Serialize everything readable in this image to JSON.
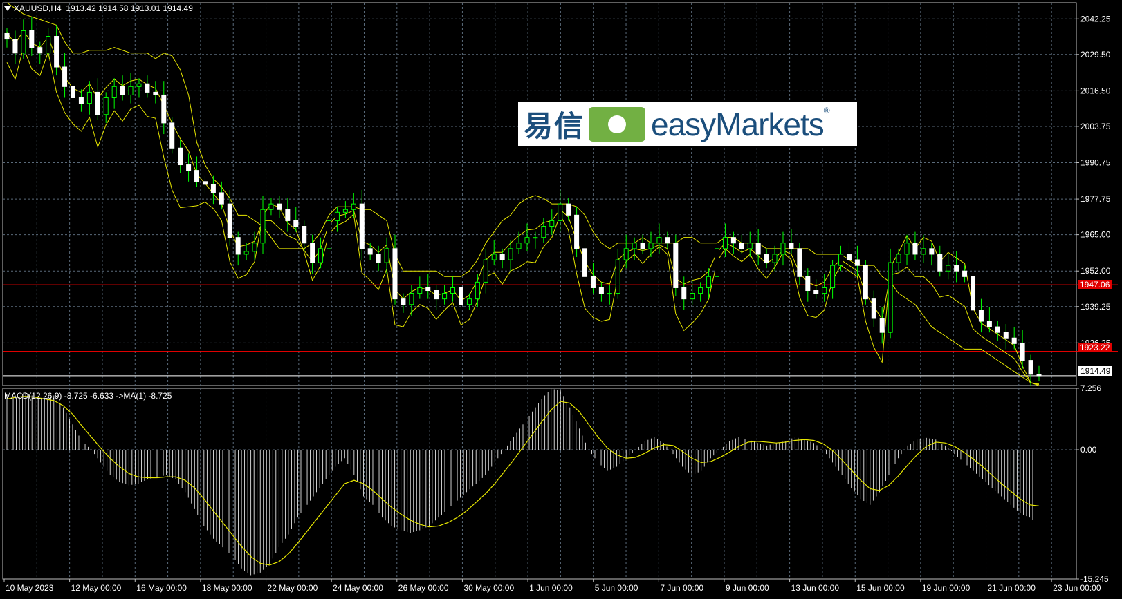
{
  "header": {
    "symbol": "XAUUSD,H4",
    "ohlc": "1913.42 1914.58 1913.01 1914.49"
  },
  "macd_header": {
    "text": "MACD(12,26,9) -8.725 -6.633 ->MA(1) -8.725"
  },
  "price_tags": {
    "resistance_1": "1947.06",
    "resistance_2": "1923.22",
    "current": "1914.49"
  },
  "logo": {
    "chinese": "易信",
    "brand": "easyMarkets",
    "reg": "®"
  },
  "colors": {
    "bull": "#00ff00",
    "bear": "#ffffff",
    "band": "#e8e800",
    "grid": "#5a6a7a",
    "level": "#ff0000",
    "macd_bar": "#ffffff",
    "macd_signal": "#e8e800"
  },
  "chart_data": [
    {
      "type": "candlestick",
      "title": "XAUUSD,H4",
      "y_ticks": [
        "2042.25",
        "2029.50",
        "2016.50",
        "2003.75",
        "1990.75",
        "1977.75",
        "1965.00",
        "1952.00",
        "1939.25",
        "1926.25"
      ],
      "x_ticks": [
        "10 May 2023",
        "12 May 00:00",
        "16 May 00:00",
        "18 May 00:00",
        "22 May 00:00",
        "24 May 00:00",
        "26 May 00:00",
        "30 May 00:00",
        "1 Jun 00:00",
        "5 Jun 00:00",
        "7 Jun 00:00",
        "9 Jun 00:00",
        "13 Jun 00:00",
        "15 Jun 00:00",
        "19 Jun 00:00",
        "21 Jun 00:00",
        "23 Jun 00:00"
      ],
      "ylim": [
        1911,
        2048
      ],
      "horizontal_levels": [
        1947.06,
        1923.22
      ],
      "current_price": 1914.49,
      "close_series": [
        2035,
        2030,
        2038,
        2032,
        2030,
        2036,
        2025,
        2018,
        2014,
        2012,
        2016,
        2008,
        2014,
        2018,
        2015,
        2018,
        2019,
        2016,
        2015,
        2005,
        1996,
        1990,
        1988,
        1984,
        1983,
        1980,
        1976,
        1964,
        1958,
        1959,
        1962,
        1974,
        1976,
        1974,
        1970,
        1968,
        1962,
        1955,
        1960,
        1970,
        1973,
        1974,
        1976,
        1960,
        1958,
        1955,
        1960,
        1942,
        1940,
        1944,
        1946,
        1945,
        1942,
        1944,
        1946,
        1940,
        1942,
        1948,
        1956,
        1958,
        1956,
        1960,
        1962,
        1964,
        1964,
        1968,
        1970,
        1976,
        1972,
        1960,
        1950,
        1946,
        1944,
        1944,
        1956,
        1960,
        1962,
        1960,
        1962,
        1964,
        1962,
        1946,
        1942,
        1944,
        1946,
        1950,
        1960,
        1964,
        1962,
        1960,
        1962,
        1958,
        1955,
        1958,
        1962,
        1960,
        1950,
        1945,
        1944,
        1946,
        1954,
        1958,
        1956,
        1954,
        1942,
        1935,
        1930,
        1955,
        1958,
        1962,
        1958,
        1960,
        1958,
        1952,
        1954,
        1952,
        1950,
        1938,
        1934,
        1932,
        1930,
        1928,
        1926,
        1920,
        1915,
        1914.49
      ],
      "bollinger_upper": [
        2048,
        2046,
        2044,
        2043,
        2042,
        2041,
        2040,
        2034,
        2030,
        2030,
        2031,
        2031,
        2031,
        2032,
        2031,
        2030,
        2030,
        2030,
        2028,
        2030,
        2029,
        2024,
        2015,
        1998,
        1990,
        1985,
        1982,
        1978,
        1972,
        1972,
        1970,
        1968,
        1964,
        1960,
        1960,
        1960,
        1960,
        1962,
        1966,
        1972,
        1975,
        1975,
        1975,
        1974,
        1974,
        1972,
        1970,
        1958,
        1952,
        1952,
        1952,
        1952,
        1952,
        1950,
        1950,
        1950,
        1952,
        1956,
        1962,
        1966,
        1970,
        1972,
        1976,
        1978,
        1979,
        1978,
        1976,
        1976,
        1976,
        1975,
        1972,
        1966,
        1962,
        1960,
        1962,
        1962,
        1962,
        1964,
        1962,
        1962,
        1962,
        1962,
        1964,
        1964,
        1962,
        1962,
        1962,
        1964,
        1964,
        1962,
        1962,
        1962,
        1960,
        1960,
        1960,
        1960,
        1960,
        1960,
        1958,
        1958,
        1958,
        1958,
        1956,
        1954,
        1954,
        1954,
        1950,
        1948,
        1944,
        1942,
        1940,
        1936,
        1932,
        1930,
        1928,
        1926,
        1924,
        1924,
        1924,
        1922,
        1920,
        1918,
        1916,
        1914,
        1912,
        1911
      ]
    },
    {
      "type": "bar",
      "title": "MACD(12,26,9) -8.725 -6.633 ->MA(1) -8.725",
      "y_ticks": [
        "7.256",
        "0.00",
        "-15.245"
      ],
      "ylim": [
        -15.245,
        7.256
      ],
      "macd_values": [
        6.5,
        6.0,
        6.8,
        6.2,
        6.0,
        6.4,
        5.0,
        3.0,
        1.0,
        0.0,
        -1.5,
        -3.0,
        -3.8,
        -4.2,
        -4.0,
        -3.5,
        -3.2,
        -3.0,
        -3.5,
        -5.0,
        -7.0,
        -9.0,
        -10.5,
        -11.5,
        -12.5,
        -14.0,
        -14.8,
        -14.5,
        -13.5,
        -11.5,
        -10.0,
        -8.0,
        -6.5,
        -5.0,
        -3.5,
        -2.0,
        -1.0,
        -3.0,
        -5.5,
        -6.5,
        -8.0,
        -9.0,
        -9.5,
        -9.8,
        -9.5,
        -9.0,
        -8.0,
        -7.0,
        -6.0,
        -5.0,
        -4.0,
        -3.0,
        -1.5,
        0.0,
        1.5,
        3.0,
        4.5,
        6.0,
        7.2,
        7.0,
        5.0,
        2.5,
        0.0,
        -1.5,
        -2.5,
        -2.0,
        -1.0,
        0.0,
        1.0,
        1.5,
        0.8,
        -0.5,
        -2.0,
        -3.0,
        -2.5,
        -1.0,
        0.0,
        1.0,
        1.5,
        1.2,
        0.8,
        0.5,
        0.8,
        1.0,
        1.5,
        1.2,
        0.8,
        0.0,
        -1.5,
        -3.0,
        -4.5,
        -5.8,
        -6.5,
        -5.0,
        -3.0,
        -1.0,
        0.5,
        1.2,
        1.4,
        1.2,
        0.5,
        -0.5,
        -1.5,
        -2.5,
        -3.5,
        -4.5,
        -5.5,
        -6.5,
        -7.5,
        -8.0,
        -8.725
      ],
      "signal_values": [
        6.0,
        6.2,
        6.3,
        6.2,
        6.0,
        5.8,
        5.2,
        4.2,
        2.8,
        1.5,
        0.2,
        -1.0,
        -2.0,
        -2.8,
        -3.2,
        -3.3,
        -3.3,
        -3.2,
        -3.2,
        -3.6,
        -4.5,
        -5.8,
        -7.2,
        -8.6,
        -10.0,
        -11.4,
        -12.6,
        -13.4,
        -13.6,
        -13.2,
        -12.3,
        -11.0,
        -9.6,
        -8.2,
        -6.8,
        -5.4,
        -4.0,
        -3.6,
        -4.0,
        -4.8,
        -5.8,
        -6.8,
        -7.6,
        -8.3,
        -8.8,
        -9.1,
        -9.0,
        -8.6,
        -8.0,
        -7.2,
        -6.2,
        -5.2,
        -4.0,
        -2.6,
        -1.2,
        0.3,
        1.8,
        3.3,
        4.7,
        5.7,
        5.5,
        4.5,
        3.0,
        1.5,
        0.2,
        -0.6,
        -1.0,
        -0.9,
        -0.4,
        0.2,
        0.6,
        0.5,
        -0.2,
        -1.0,
        -1.5,
        -1.4,
        -0.9,
        -0.3,
        0.4,
        0.9,
        1.0,
        0.9,
        0.8,
        0.9,
        1.1,
        1.2,
        1.1,
        0.7,
        -0.1,
        -1.2,
        -2.4,
        -3.6,
        -4.6,
        -4.8,
        -4.2,
        -3.1,
        -1.8,
        -0.6,
        0.4,
        0.9,
        0.8,
        0.4,
        -0.3,
        -1.1,
        -2.0,
        -3.0,
        -4.0,
        -4.9,
        -5.8,
        -6.5,
        -6.633
      ]
    }
  ]
}
